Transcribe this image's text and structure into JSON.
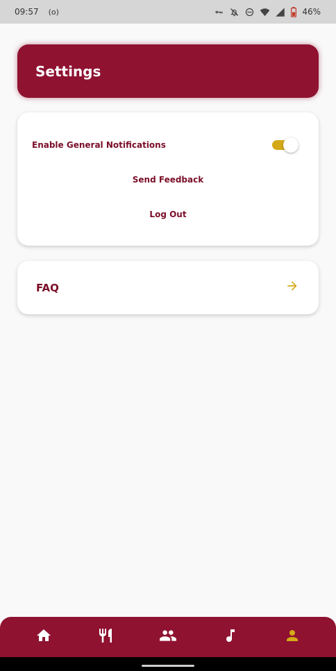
{
  "status_bar": {
    "time": "09:57",
    "extra": "(o)",
    "battery": "46%",
    "icons": [
      "key-icon",
      "bell-off-icon",
      "dnd-icon",
      "wifi-icon",
      "signal-icon",
      "battery-icon"
    ]
  },
  "header": {
    "title": "Settings"
  },
  "settings": {
    "notifications_label": "Enable General Notifications",
    "notifications_enabled": true,
    "send_feedback_label": "Send Feedback",
    "logout_label": "Log Out"
  },
  "faq": {
    "label": "FAQ",
    "icon": "arrow-right-icon"
  },
  "nav": {
    "items": [
      {
        "icon": "home-icon",
        "active": false
      },
      {
        "icon": "restaurant-icon",
        "active": false
      },
      {
        "icon": "people-icon",
        "active": false
      },
      {
        "icon": "music-note-icon",
        "active": false
      },
      {
        "icon": "person-icon",
        "active": true
      }
    ]
  },
  "colors": {
    "primary": "#8f1230",
    "accent": "#d4a917",
    "text_dark_red": "#7a0e28",
    "background": "#f9f9f9"
  }
}
